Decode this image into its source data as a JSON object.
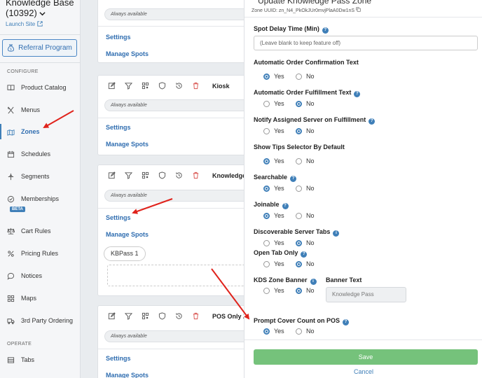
{
  "sidebar": {
    "brand_line1": "Knowledge Base",
    "brand_line2": "(10392)",
    "launch_site": "Launch Site",
    "referral_label": "Referral Program",
    "configure_label": "CONFIGURE",
    "operate_label": "OPERATE",
    "beta_label": "BETA",
    "items": [
      {
        "label": "Product Catalog",
        "icon": "book-icon"
      },
      {
        "label": "Menus",
        "icon": "utensils-icon"
      },
      {
        "label": "Zones",
        "icon": "map-icon"
      },
      {
        "label": "Schedules",
        "icon": "calendar-icon"
      },
      {
        "label": "Segments",
        "icon": "split-icon"
      },
      {
        "label": "Memberships",
        "icon": "check-circle-icon"
      },
      {
        "label": "Cart Rules",
        "icon": "scale-icon"
      },
      {
        "label": "Pricing Rules",
        "icon": "percent-icon"
      },
      {
        "label": "Notices",
        "icon": "chat-icon"
      },
      {
        "label": "Maps",
        "icon": "grid-icon"
      },
      {
        "label": "3rd Party Ordering",
        "icon": "truck-icon"
      },
      {
        "label": "Tabs",
        "icon": "tab-icon"
      }
    ]
  },
  "zones": {
    "always_available": "Always available",
    "settings_label": "Settings",
    "manage_spots_label": "Manage Spots",
    "cards": [
      {
        "name": ""
      },
      {
        "name": "Kiosk"
      },
      {
        "name": "Knowledge",
        "spot_pill": "KBPass 1"
      },
      {
        "name": "POS Only Zo"
      }
    ]
  },
  "modal": {
    "title": "Update Knowledge Pass Zone",
    "uuid_label": "Zone UUID: zn_N4_PkOkJUr0mvjPlaA0Dw1nS",
    "spot_delay_label": "Spot Delay Time (Min)",
    "spot_delay_placeholder": "(Leave blank to keep feature off)",
    "yes_label": "Yes",
    "no_label": "No",
    "fields": [
      {
        "label": "Automatic Order Confirmation Text",
        "help": false,
        "value": "Yes"
      },
      {
        "label": "Automatic Order Fulfillment Text",
        "help": true,
        "value": "No"
      },
      {
        "label": "Notify Assigned Server on Fulfillment",
        "help": true,
        "value": "No"
      },
      {
        "label": "Show Tips Selector By Default",
        "help": false,
        "value": "Yes"
      },
      {
        "label": "Searchable",
        "help": true,
        "value": "Yes"
      },
      {
        "label": "Joinable",
        "help": true,
        "value": "Yes"
      },
      {
        "label": "Discoverable Server Tabs",
        "help": "info",
        "value": "No"
      },
      {
        "label": "Open Tab Only",
        "help": true,
        "value": "No"
      },
      {
        "label": "KDS Zone Banner",
        "help": "info",
        "value": "No"
      },
      {
        "label": "Prompt Cover Count on POS",
        "help": true,
        "value": "Yes"
      }
    ],
    "banner_text_label": "Banner Text",
    "banner_text_placeholder": "Knowledge Pass",
    "save_label": "Save",
    "cancel_label": "Cancel"
  },
  "colors": {
    "accent": "#3f7fb8",
    "save_button": "#75c27b",
    "annotation_arrow": "#e0231c",
    "delete_icon": "#d9534f"
  }
}
